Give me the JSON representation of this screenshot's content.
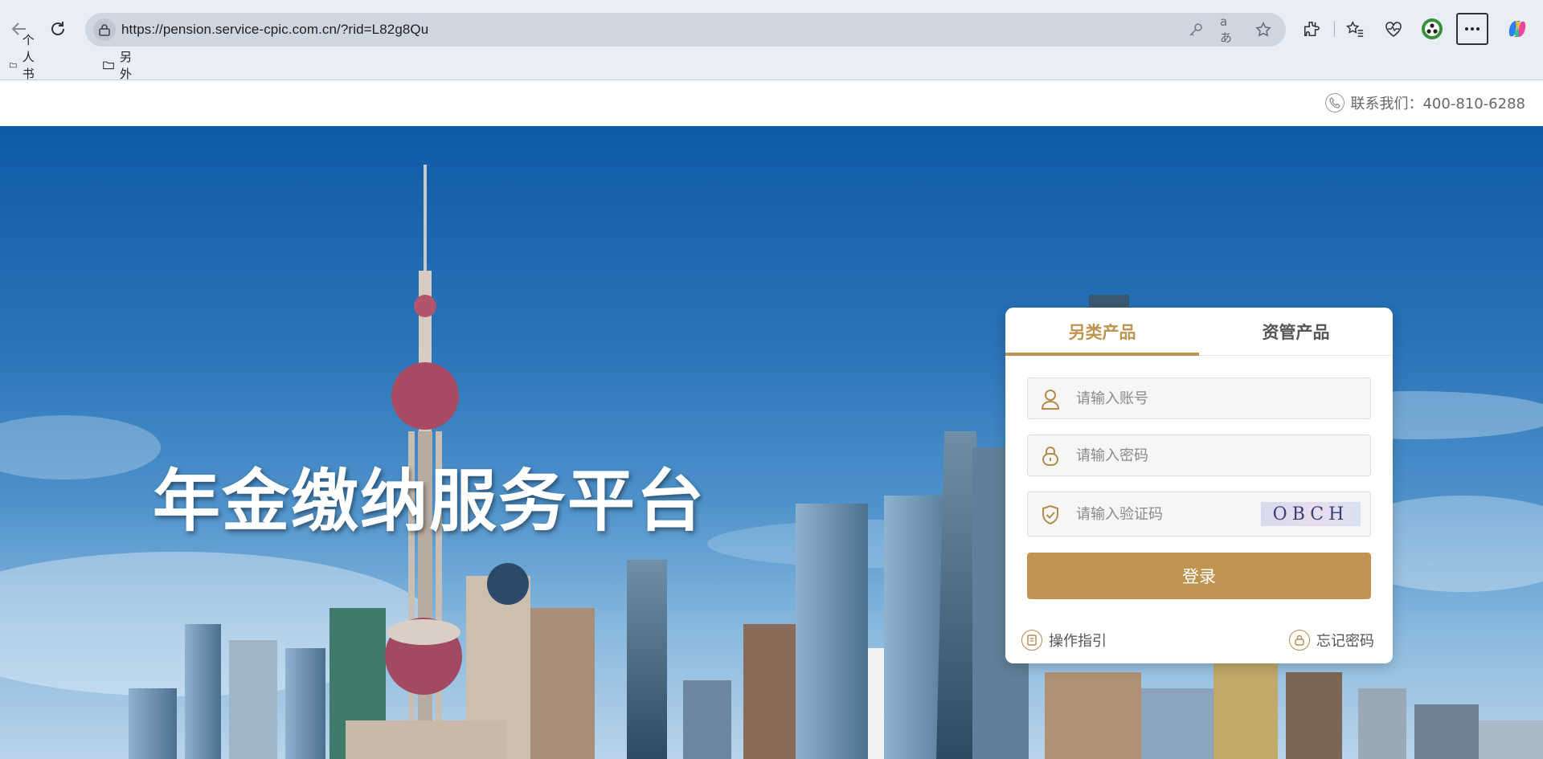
{
  "browser": {
    "url": "https://pension.service-cpic.com.cn/?rid=L82g8Qu",
    "bookmarks": [
      {
        "label": "个人书签"
      },
      {
        "label": "另外"
      }
    ]
  },
  "header": {
    "contact": "联系我们：400-810-6288"
  },
  "hero": {
    "title": "年金缴纳服务平台"
  },
  "login": {
    "tabs": [
      {
        "label": "另类产品",
        "active": true
      },
      {
        "label": "资管产品",
        "active": false
      }
    ],
    "account_placeholder": "请输入账号",
    "password_placeholder": "请输入密码",
    "captcha_placeholder": "请输入验证码",
    "captcha_text": "OBCH",
    "submit_label": "登录",
    "guide_label": "操作指引",
    "forgot_label": "忘记密码"
  },
  "colors": {
    "accent": "#bf9450",
    "chrome_bg": "#e9eef6"
  }
}
